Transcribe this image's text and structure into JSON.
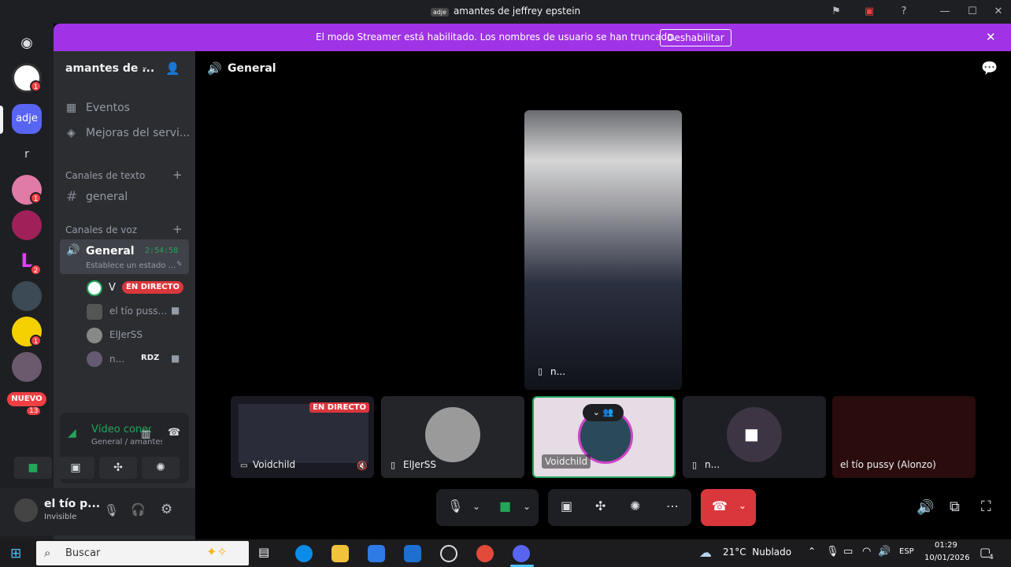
{
  "window": {
    "title": "amantes de jeffrey epstein",
    "app_label": "adje"
  },
  "banner": {
    "message": "El modo Streamer está habilitado. Los nombres de usuario se han truncado.",
    "button": "Deshabilitar"
  },
  "rail": {
    "servers": [
      {
        "name": "discord-home",
        "badge": ""
      },
      {
        "name": "server-panda",
        "badge": "1"
      },
      {
        "name": "adje",
        "label": "adje",
        "badge": ""
      },
      {
        "name": "server-r",
        "label": "r",
        "badge": ""
      },
      {
        "name": "server-anime-pink",
        "badge": "1"
      },
      {
        "name": "server-anime-red",
        "badge": ""
      },
      {
        "name": "server-l",
        "label": "L",
        "badge": "2"
      },
      {
        "name": "server-dark",
        "badge": ""
      },
      {
        "name": "server-yellow",
        "badge": "1"
      },
      {
        "name": "server-anime",
        "badge": ""
      }
    ],
    "new_label": "NUEVO",
    "new_count": "13"
  },
  "sidebar": {
    "server_name": "amantes de ...",
    "events": "Eventos",
    "boosts": "Mejoras del servi...",
    "text_category": "Canales de texto",
    "text_channels": [
      "general"
    ],
    "voice_category": "Canales de voz",
    "voice_channel": {
      "name": "General",
      "timer": "2:54:58",
      "status": "Establece un estado ..."
    },
    "members": [
      {
        "name": "V",
        "tag": "EN DIRECTO"
      },
      {
        "name": "el tío puss..."
      },
      {
        "name": "ElJerSS"
      },
      {
        "name": "n...",
        "tag": "RDZ"
      }
    ]
  },
  "voice_panel": {
    "status": "Vídeo conectad",
    "location": "General / amantes..."
  },
  "user": {
    "name": "el tío p...",
    "status": "Invisible"
  },
  "main": {
    "channel": "General",
    "focused_user": "n...",
    "tiles": [
      {
        "label": "Voidchild",
        "live": "EN DIRECTO"
      },
      {
        "label": "ElJerSS"
      },
      {
        "label": "Voidchild"
      },
      {
        "label": "n..."
      },
      {
        "label": "el tío pussy (Alonzo)"
      }
    ]
  },
  "taskbar": {
    "search_placeholder": "Buscar",
    "weather": "21°C  Nublado",
    "lang": "ESP",
    "time": "01:29",
    "date": "10/01/2026",
    "notif": "4"
  },
  "colors": {
    "accent": "#a033e6",
    "green": "#23a55a",
    "red": "#f23f43",
    "live": "#da373c"
  }
}
